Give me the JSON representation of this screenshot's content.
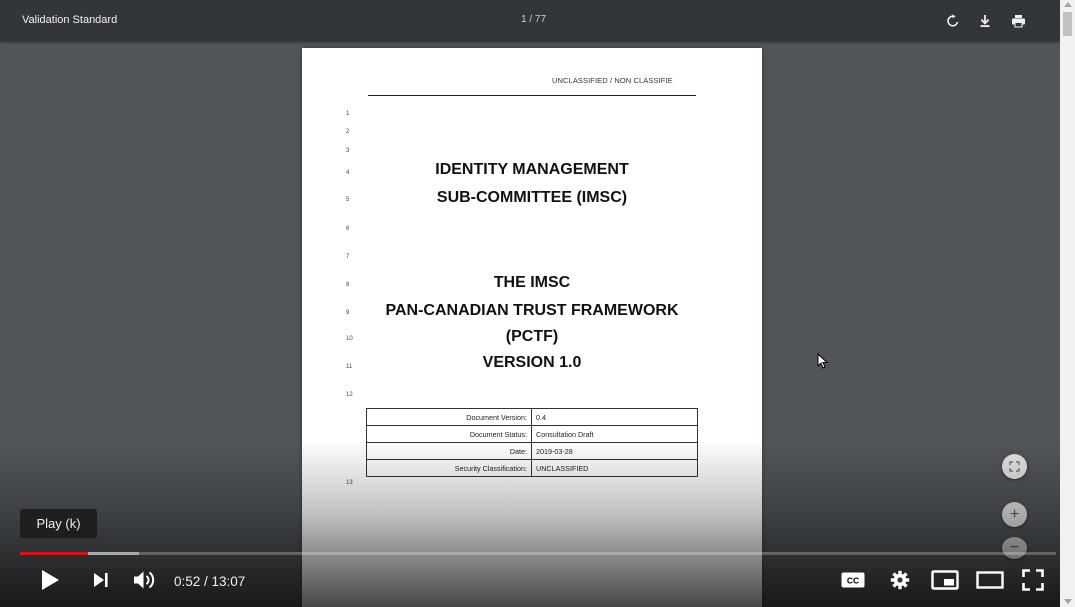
{
  "viewer": {
    "title": "Validation Standard",
    "page_indicator": "1 / 77",
    "rotate_icon": "rotate-icon",
    "download_icon": "download-icon",
    "print_icon": "print-icon"
  },
  "document": {
    "header": "UNCLASSIFIED / NON CLASSIFIE",
    "line_numbers": [
      "1",
      "2",
      "3",
      "4",
      "5",
      "6",
      "7",
      "8",
      "9",
      "10",
      "11",
      "12",
      "13"
    ],
    "title_lines": [
      "IDENTITY MANAGEMENT",
      "SUB-COMMITTEE (IMSC)",
      "THE IMSC",
      "PAN-CANADIAN TRUST FRAMEWORK",
      "(PCTF)",
      "VERSION 1.0"
    ],
    "table": [
      {
        "label": "Document Version:",
        "value": "0.4"
      },
      {
        "label": "Document Status:",
        "value": "Consultation Draft"
      },
      {
        "label": "Date:",
        "value": "2019-03-28"
      },
      {
        "label": "Security Classification:",
        "value": "UNCLASSIFIED"
      }
    ]
  },
  "zoom_controls": {
    "fit_icon": "fit-to-page-icon",
    "zoom_in_label": "+",
    "zoom_out_label": "−"
  },
  "player": {
    "tooltip": "Play (k)",
    "time": "0:52 / 13:07",
    "progress_played_fraction": 0.066,
    "progress_buffered_fraction": 0.115,
    "progress_color": "#ff0000",
    "icons": [
      "play-icon",
      "next-icon",
      "volume-icon",
      "captions-icon",
      "settings-icon",
      "miniplayer-icon",
      "theater-icon",
      "fullscreen-icon"
    ],
    "cc_label": "CC"
  }
}
